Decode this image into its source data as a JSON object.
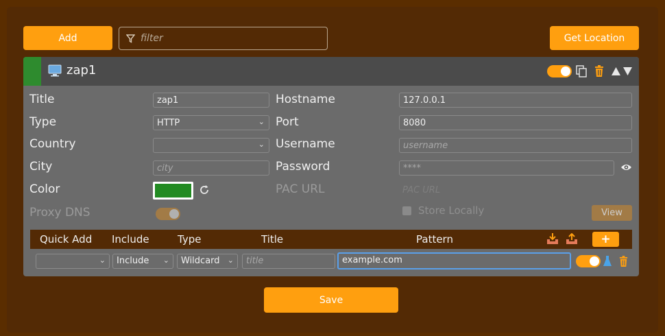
{
  "toolbar": {
    "add_label": "Add",
    "filter_placeholder": "filter",
    "get_location_label": "Get Location"
  },
  "proxy": {
    "name": "zap1",
    "enabled": true,
    "fields": {
      "title_label": "Title",
      "title_value": "zap1",
      "type_label": "Type",
      "type_value": "HTTP",
      "country_label": "Country",
      "country_value": "",
      "city_label": "City",
      "city_placeholder": "city",
      "color_label": "Color",
      "color_value": "#228b22",
      "proxy_dns_label": "Proxy DNS",
      "proxy_dns_enabled": true,
      "hostname_label": "Hostname",
      "hostname_value": "127.0.0.1",
      "port_label": "Port",
      "port_value": "8080",
      "username_label": "Username",
      "username_placeholder": "username",
      "password_label": "Password",
      "password_placeholder": "****",
      "pac_url_label": "PAC URL",
      "pac_url_placeholder": "PAC URL",
      "store_locally_label": "Store Locally",
      "view_label": "View"
    },
    "patterns": {
      "headers": {
        "quick_add": "Quick Add",
        "include": "Include",
        "type": "Type",
        "title": "Title",
        "pattern": "Pattern"
      },
      "add_label": "+",
      "row": {
        "quick_add": "",
        "include": "Include",
        "type": "Wildcard",
        "title_placeholder": "title",
        "pattern": "example.com",
        "enabled": true
      }
    }
  },
  "footer": {
    "save_label": "Save"
  },
  "colors": {
    "accent": "#ff9f0f",
    "background": "#5a2d00",
    "card": "#6b6b6b",
    "stripe": "#2e8b2e"
  }
}
